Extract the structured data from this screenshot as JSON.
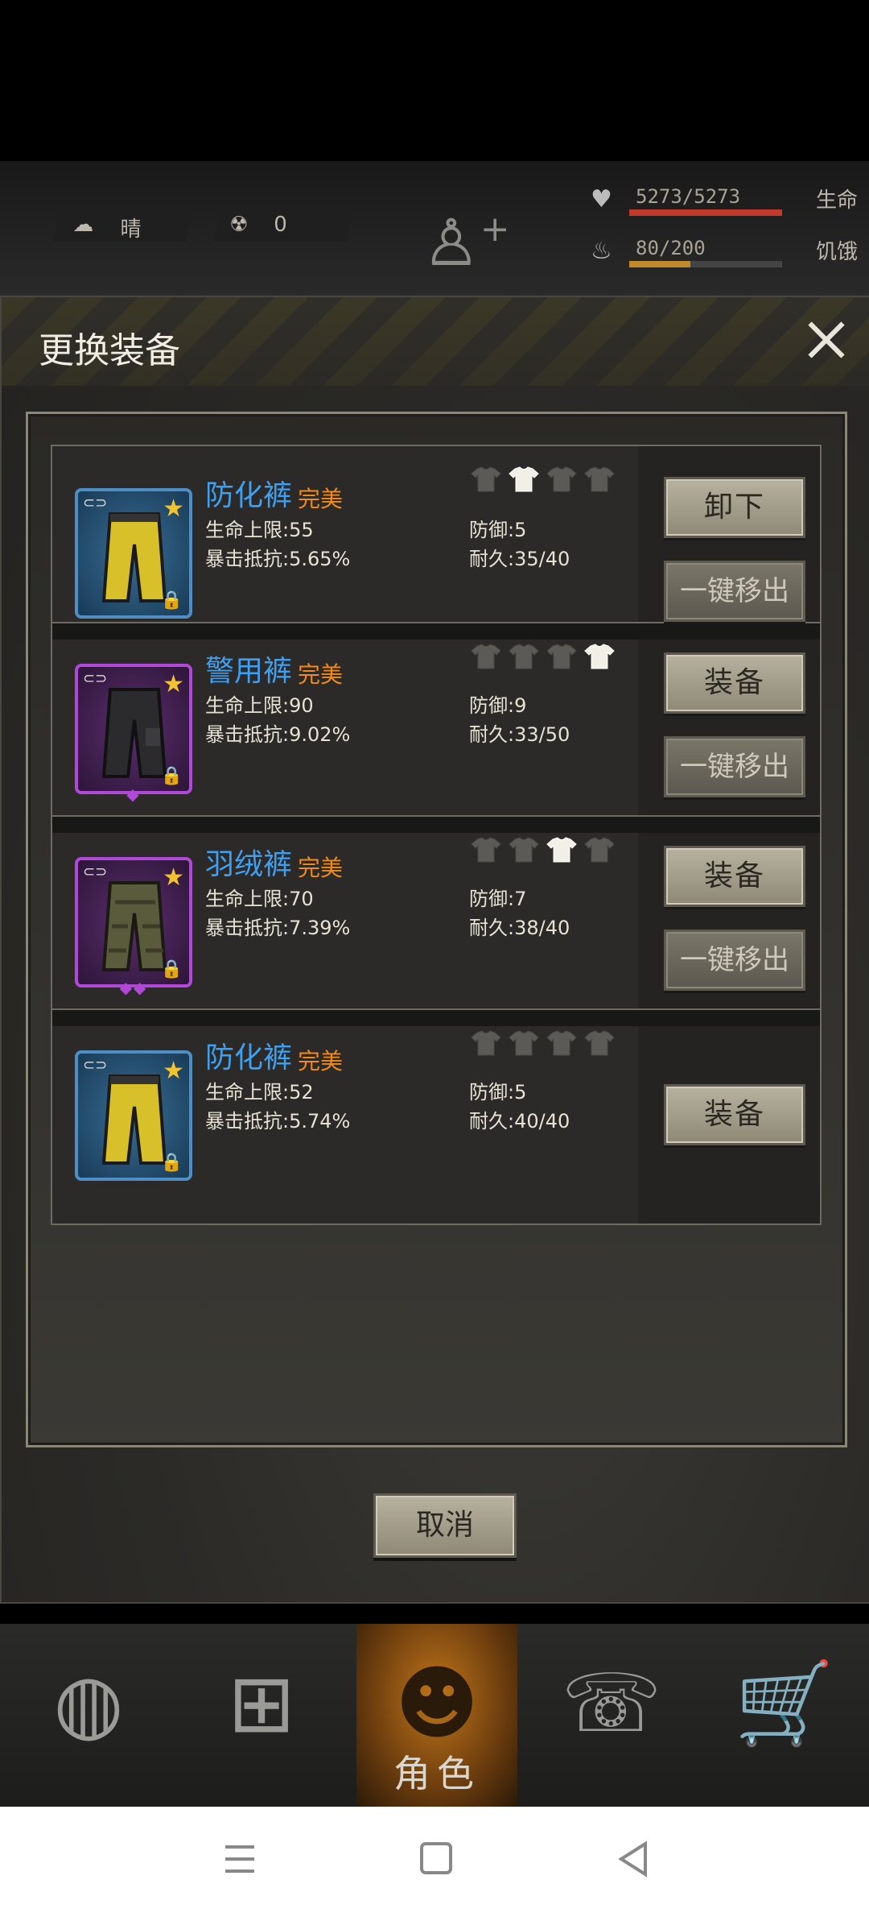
{
  "status_bar": {
    "weather_label": "晴",
    "radiation_value": "0"
  },
  "stats": [
    {
      "value": "5273/5273",
      "label": "生命",
      "fill": 1.0,
      "color": "#c0392b"
    },
    {
      "value": "80/200",
      "label": "饥饿",
      "fill": 0.4,
      "color": "#c08a2a"
    }
  ],
  "dialog": {
    "title": "更换装备",
    "cancel_label": "取消"
  },
  "items": [
    {
      "name": "防化裤",
      "quality": "完美",
      "hp_max": "生命上限:55",
      "crit_resist": "暴击抵抗:5.65%",
      "defense": "防御:5",
      "durability": "耐久:35/40",
      "rarity_color": "blue",
      "gems": "",
      "active_slot": 2,
      "buttons": [
        "卸下",
        "一键移出"
      ]
    },
    {
      "name": "警用裤",
      "quality": "完美",
      "hp_max": "生命上限:90",
      "crit_resist": "暴击抵抗:9.02%",
      "defense": "防御:9",
      "durability": "耐久:33/50",
      "rarity_color": "purple",
      "gems": "◆",
      "active_slot": 4,
      "buttons": [
        "装备",
        "一键移出"
      ]
    },
    {
      "name": "羽绒裤",
      "quality": "完美",
      "hp_max": "生命上限:70",
      "crit_resist": "暴击抵抗:7.39%",
      "defense": "防御:7",
      "durability": "耐久:38/40",
      "rarity_color": "purple",
      "gems": "◆◆",
      "active_slot": 3,
      "buttons": [
        "装备",
        "一键移出"
      ]
    },
    {
      "name": "防化裤",
      "quality": "完美",
      "hp_max": "生命上限:52",
      "crit_resist": "暴击抵抗:5.74%",
      "defense": "防御:5",
      "durability": "耐久:40/40",
      "rarity_color": "blue",
      "gems": "",
      "active_slot": 0,
      "buttons": [
        "装备"
      ]
    }
  ],
  "nav": {
    "items": [
      "world-icon",
      "backpack-icon",
      "character-icon",
      "radio-icon",
      "cart-icon"
    ],
    "active_label": "角色"
  },
  "colors": {
    "name_blue": "#3f9ff0",
    "quality_orange": "#f08a1c",
    "rarity_blue": "#4f8ec4",
    "rarity_purple": "#b048d8"
  }
}
